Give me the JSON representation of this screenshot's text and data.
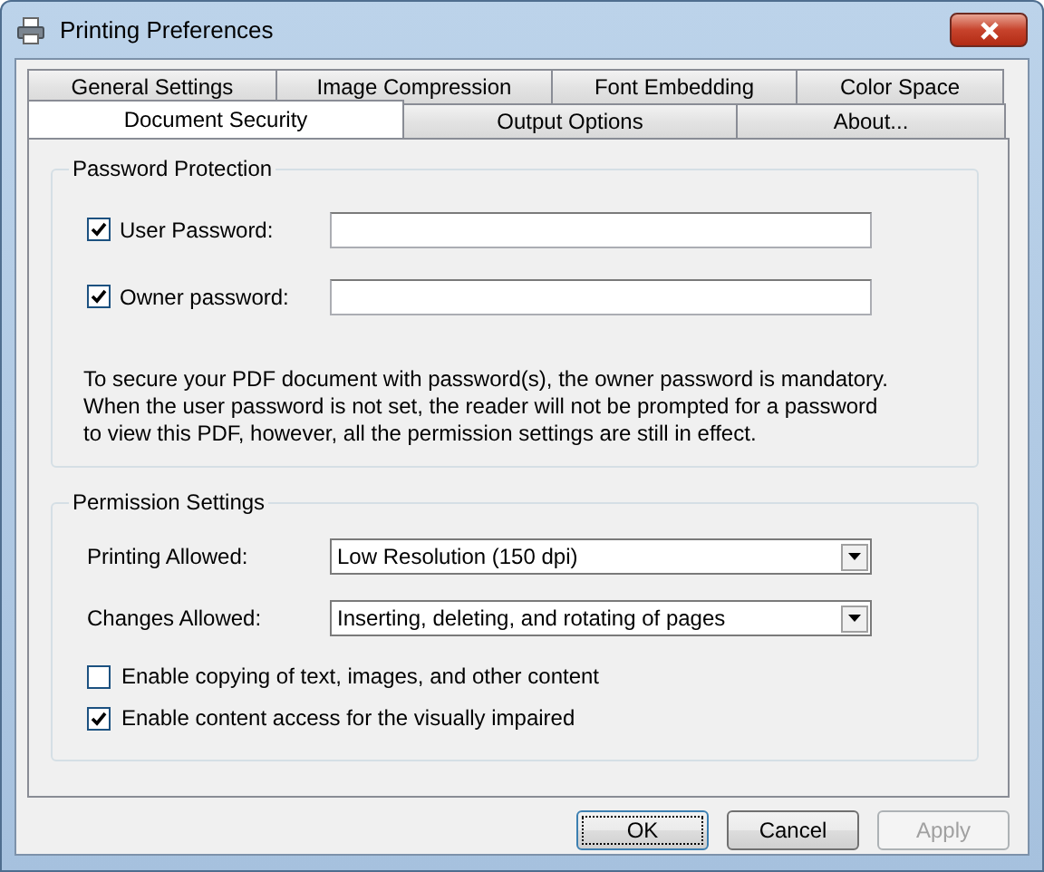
{
  "window": {
    "title": "Printing Preferences"
  },
  "tabs": [
    [
      {
        "label": "General Settings",
        "selected": false
      },
      {
        "label": "Image Compression",
        "selected": false
      },
      {
        "label": "Font Embedding",
        "selected": false
      },
      {
        "label": "Color Space",
        "selected": false
      }
    ],
    [
      {
        "label": "Document Security",
        "selected": true
      },
      {
        "label": "Output Options",
        "selected": false
      },
      {
        "label": "About...",
        "selected": false
      }
    ]
  ],
  "password_protection": {
    "title": "Password Protection",
    "fields": [
      {
        "label": "User Password:",
        "checked": true
      },
      {
        "label": "Owner password:",
        "checked": true
      }
    ],
    "note": "To secure your PDF document with password(s), the owner password is mandatory. When the user password is not set, the reader will not be prompted for a password to view this PDF, however, all the permission settings are still in effect."
  },
  "permission_settings": {
    "title": "Permission Settings",
    "dropdowns": [
      {
        "label": "Printing Allowed:",
        "value": "Low Resolution (150 dpi)"
      },
      {
        "label": "Changes Allowed:",
        "value": "Inserting, deleting, and rotating of pages"
      }
    ],
    "checkboxes": [
      {
        "label": "Enable copying of text, images, and other content",
        "checked": false
      },
      {
        "label": "Enable content access for the visually impaired",
        "checked": true
      }
    ]
  },
  "buttons": [
    {
      "label": "OK",
      "focused": true,
      "disabled": false
    },
    {
      "label": "Cancel",
      "focused": false,
      "disabled": false
    },
    {
      "label": "Apply",
      "focused": false,
      "disabled": true
    }
  ]
}
